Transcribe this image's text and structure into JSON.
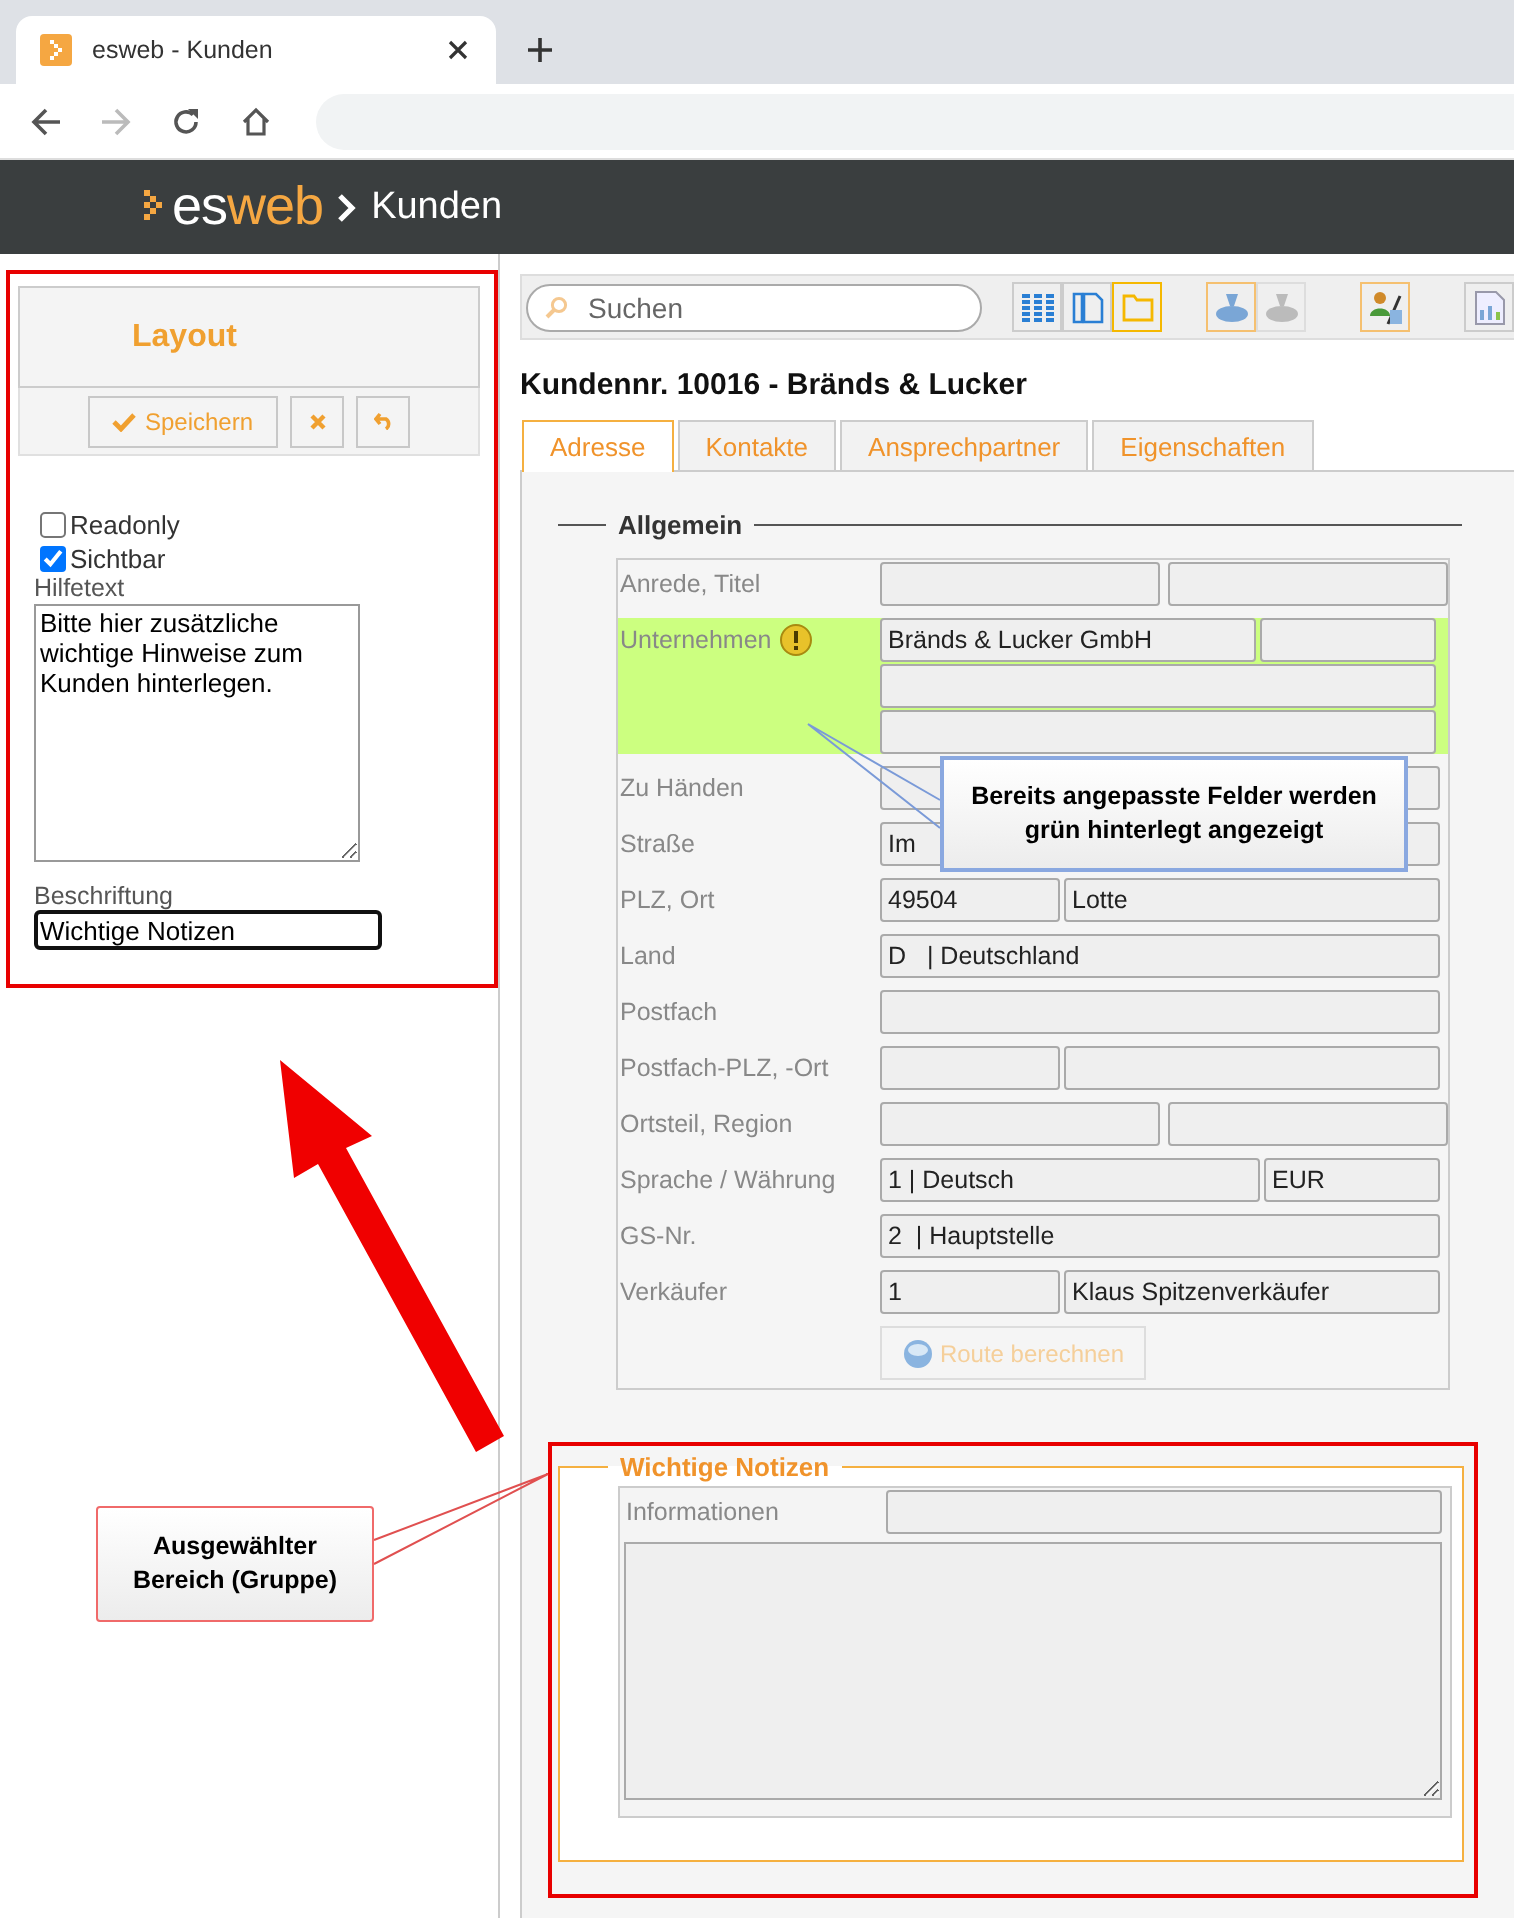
{
  "browser": {
    "tab_title": "esweb - Kunden",
    "forward_disabled": true
  },
  "app": {
    "logo": [
      "es",
      "web"
    ],
    "breadcrumb": "Kunden"
  },
  "layout_panel": {
    "title": "Layout",
    "highlighted": true,
    "save_label": "Speichern",
    "options": [
      {
        "label": "Readonly",
        "checked": false
      },
      {
        "label": "Sichtbar",
        "checked": true
      }
    ],
    "help_label": "Hilfetext",
    "help_text": "Bitte hier zusätzliche wichtige Hinweise zum Kunden hinterlegen.",
    "caption_label": "Beschriftung",
    "caption_value": "Wichtige Notizen"
  },
  "toolbar": {
    "search_placeholder": "Suchen",
    "views": [
      {
        "kind": "grid",
        "selected": false
      },
      {
        "kind": "page",
        "selected": false
      },
      {
        "kind": "folder",
        "selected": true
      }
    ],
    "tools": [
      {
        "kind": "stamp",
        "disabled": false,
        "highlighted": true
      },
      {
        "kind": "stamp",
        "disabled": true,
        "highlighted": false
      },
      {
        "kind": "people",
        "disabled": false,
        "highlighted": true
      },
      {
        "kind": "report",
        "disabled": false,
        "highlighted": false
      }
    ]
  },
  "record_title": "Kundennr. 10016 - Bränds & Lucker",
  "tabs": [
    {
      "label": "Adresse",
      "selected": true
    },
    {
      "label": "Kontakte",
      "selected": false
    },
    {
      "label": "Ansprechpartner",
      "selected": false
    },
    {
      "label": "Eigenschaften",
      "selected": false
    }
  ],
  "sections": [
    {
      "kind": "fields",
      "title": "Allgemein",
      "selected": false,
      "rows": [
        {
          "label": "Anrede, Titel",
          "highlighted": false,
          "warning": false,
          "lines": [
            {
              "kind": "half"
            }
          ]
        },
        {
          "label": "Unternehmen",
          "highlighted": true,
          "warning": true,
          "lines": [
            {
              "kind": "long-first",
              "first": "Bränds & Lucker GmbH"
            },
            {
              "kind": "single"
            },
            {
              "kind": "single"
            }
          ]
        },
        {
          "label": "Zu Händen",
          "highlighted": false,
          "warning": false,
          "lines": [
            {
              "kind": "single"
            }
          ]
        },
        {
          "label": "Straße",
          "highlighted": false,
          "warning": false,
          "lines": [
            {
              "kind": "single",
              "first": "Im"
            }
          ]
        },
        {
          "label": "PLZ, Ort",
          "highlighted": false,
          "warning": false,
          "lines": [
            {
              "kind": "short-first",
              "first": "49504",
              "second": "Lotte"
            }
          ]
        },
        {
          "label": "Land",
          "highlighted": false,
          "warning": false,
          "lines": [
            {
              "kind": "single",
              "first": "D   | Deutschland"
            }
          ]
        },
        {
          "label": "Postfach",
          "highlighted": false,
          "warning": false,
          "lines": [
            {
              "kind": "single"
            }
          ]
        },
        {
          "label": "Postfach-PLZ, -Ort",
          "highlighted": false,
          "warning": false,
          "lines": [
            {
              "kind": "short-first"
            }
          ]
        },
        {
          "label": "Ortsteil, Region",
          "highlighted": false,
          "warning": false,
          "lines": [
            {
              "kind": "half"
            }
          ]
        },
        {
          "label": "Sprache / Währung",
          "highlighted": false,
          "warning": false,
          "lines": [
            {
              "kind": "long-first",
              "first": "1 | Deutsch",
              "second": "EUR"
            }
          ]
        },
        {
          "label": "GS-Nr.",
          "highlighted": false,
          "warning": false,
          "lines": [
            {
              "kind": "single",
              "first": "2  | Hauptstelle"
            }
          ]
        },
        {
          "label": "Verkäufer",
          "highlighted": false,
          "warning": false,
          "lines": [
            {
              "kind": "short-first",
              "first": "1",
              "second": "Klaus Spitzenverkäufer"
            }
          ]
        }
      ],
      "route_button": {
        "label": "Route berechnen",
        "disabled": true
      }
    },
    {
      "kind": "notes",
      "title": "Wichtige Notizen",
      "selected": true,
      "label": "Informationen"
    }
  ],
  "annotations": [
    {
      "kind": "info",
      "text": "Bereits angepasste Felder werden grün hinterlegt angezeigt"
    },
    {
      "kind": "selection",
      "text": "Ausgewählter Bereich (Gruppe)"
    },
    {
      "kind": "arrow"
    }
  ]
}
